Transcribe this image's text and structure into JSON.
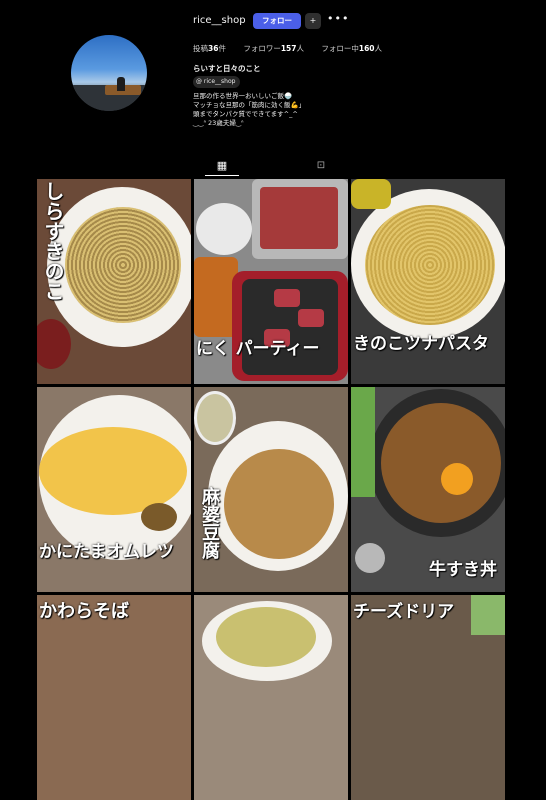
{
  "profile": {
    "username": "rice__shop",
    "follow_label": "フォロー",
    "add_user_symbol": "+",
    "more_symbol": "•••",
    "stats": {
      "posts_label": "投稿",
      "posts_count": "36",
      "posts_unit": "件",
      "followers_label": "フォロワー",
      "followers_count": "157",
      "followers_unit": "人",
      "following_label": "フォロー中",
      "following_count": "160",
      "following_unit": "人"
    },
    "display_name": "らいすと日々のこと",
    "threads_handle": "rice__shop",
    "bio": [
      "旦那の作る世界一おいしいご飯🍚",
      "マッチョな旦那の「筋肉に効く飯💪」",
      "頭までタンパク質でできてます^_^",
      "‿‿ᐢ 23歳夫婦‿ᐢ"
    ]
  },
  "tabs": [
    {
      "name": "posts",
      "icon": "grid-icon",
      "glyph": "▦",
      "active": true
    },
    {
      "name": "tagged",
      "icon": "tagged-icon",
      "glyph": "⊡",
      "active": false
    }
  ],
  "posts": [
    {
      "caption": "しらすきのこ"
    },
    {
      "caption": "にく パーティー"
    },
    {
      "caption": "きのこツナパスタ"
    },
    {
      "caption": "かにたまオムレツ"
    },
    {
      "caption": "麻婆豆腐"
    },
    {
      "caption": "牛すき丼"
    },
    {
      "caption": "かわらそば"
    },
    {
      "caption": ""
    },
    {
      "caption": "チーズドリア"
    }
  ],
  "colors": {
    "accent": "#4b5fe8",
    "background": "#000000"
  }
}
